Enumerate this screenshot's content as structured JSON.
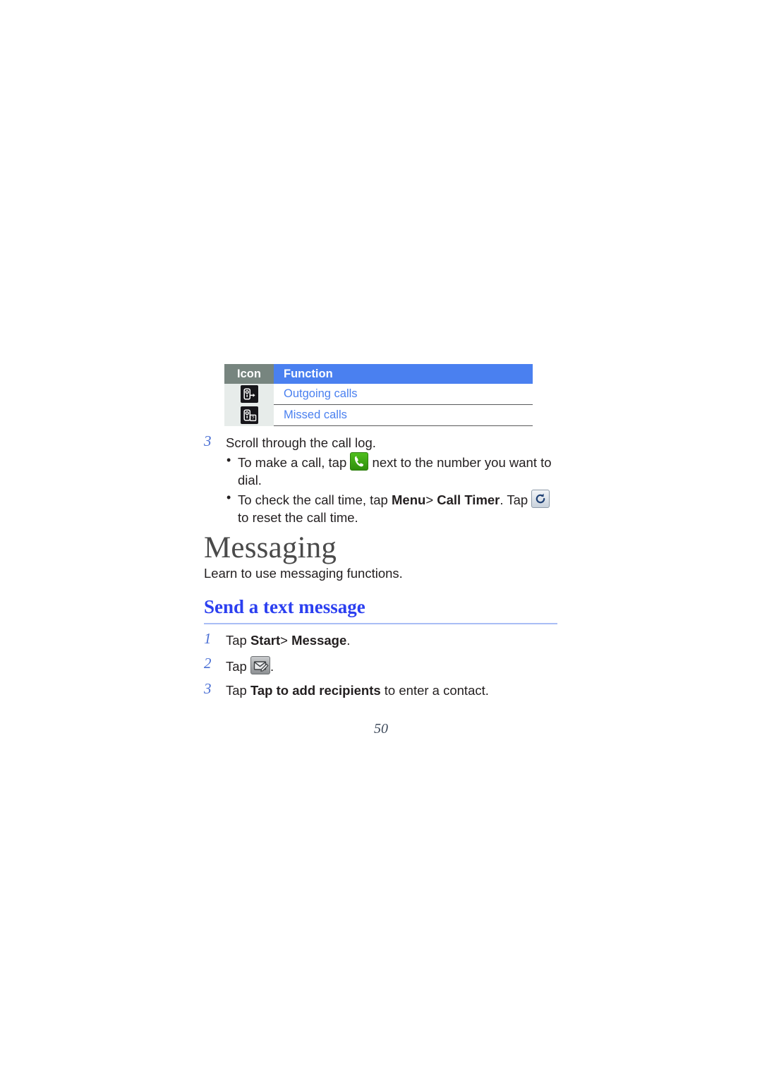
{
  "page": {
    "number": "50",
    "accent_blue": "#4a80f0",
    "heading_blue": "#2b3ff0",
    "header_grey": "#77857f",
    "row_tint": "#e7ecea"
  },
  "icon_table": {
    "headers": {
      "icon": "Icon",
      "function": "Function"
    },
    "rows": [
      {
        "icon_name": "outgoing-calls-icon",
        "function": "Outgoing calls"
      },
      {
        "icon_name": "missed-calls-icon",
        "function": "Missed calls"
      }
    ]
  },
  "call_log_step": {
    "number": "3",
    "text": "Scroll through the call log.",
    "bullets": [
      {
        "before": "To make a call, tap",
        "icon_name": "green-phone-icon",
        "after": "next to the number you want to dial."
      },
      {
        "before": "To check the call time, tap",
        "bold1": "Menu",
        "separator": ">",
        "bold2": "Call Timer",
        "middle": ". Tap",
        "icon_name": "reset-icon",
        "after": "to reset the call time."
      }
    ]
  },
  "messaging": {
    "title": "Messaging",
    "lead": "Learn to use messaging functions.",
    "section_title": "Send a text message",
    "steps": [
      {
        "number": "1",
        "prefix": "Tap",
        "bold1": "Start",
        "separator": ">",
        "bold2": "Message",
        "suffix": "."
      },
      {
        "number": "2",
        "prefix": "Tap",
        "icon_name": "compose-message-icon",
        "suffix": "."
      },
      {
        "number": "3",
        "prefix": "Tap",
        "bold1": "Tap to add recipients",
        "suffix": "to enter a contact."
      }
    ]
  }
}
